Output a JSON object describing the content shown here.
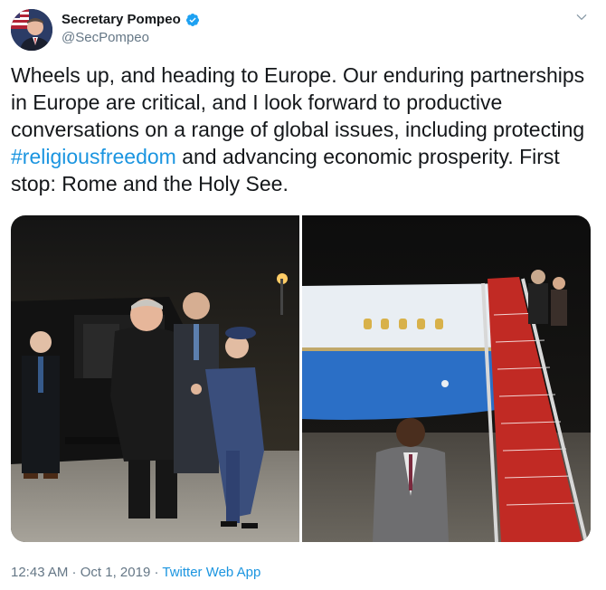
{
  "author": {
    "name": "Secretary Pompeo",
    "handle": "@SecPompeo",
    "verified": true
  },
  "tweet": {
    "text_before": "Wheels up, and heading to Europe. Our enduring partnerships in Europe are critical, and I look forward to productive conversations on a range of global issues, including protecting ",
    "hashtag": "#religiousfreedom",
    "text_after": " and advancing economic prosperity. First stop: Rome and the Holy See."
  },
  "media": {
    "photos": [
      {
        "description_icon": "photo-handshake"
      },
      {
        "description_icon": "photo-airplane-stairs"
      }
    ]
  },
  "footer": {
    "time": "12:43 AM",
    "sep1": " · ",
    "date": "Oct 1, 2019",
    "sep2": " · ",
    "source": "Twitter Web App"
  },
  "colors": {
    "link": "#1b95e0",
    "verified": "#1da1f2",
    "secondary_text": "#657786"
  }
}
